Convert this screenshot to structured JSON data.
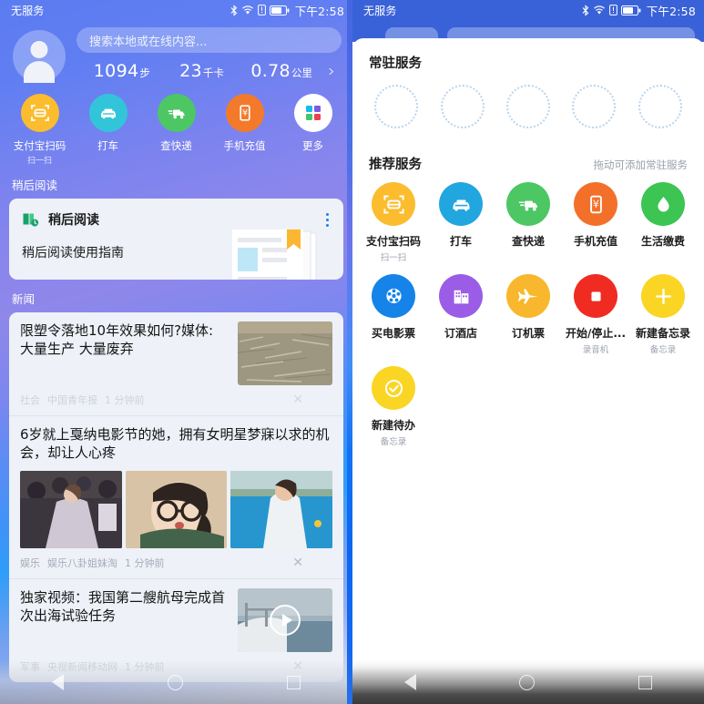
{
  "statusbar": {
    "carrier": "无服务",
    "time": "下午2:58",
    "icons": [
      "bluetooth-icon",
      "wifi-icon",
      "sim-alert-icon",
      "battery-icon"
    ]
  },
  "left_panel": {
    "search": {
      "placeholder": "搜索本地或在线内容..."
    },
    "avatar": "avatar",
    "stats": [
      {
        "num": "1094",
        "unit": "步"
      },
      {
        "num": "23",
        "unit": "千卡"
      },
      {
        "num": "0.78",
        "unit": "公里"
      }
    ],
    "stats_chevron": "›",
    "shortcuts": [
      {
        "label": "支付宝扫码",
        "sub": "扫一扫",
        "icon": "scan-code-icon",
        "color": "#fbbc2e"
      },
      {
        "label": "打车",
        "sub": "",
        "icon": "taxi-icon",
        "color": "#32c5d9"
      },
      {
        "label": "查快递",
        "sub": "",
        "icon": "delivery-truck-icon",
        "color": "#4cc764"
      },
      {
        "label": "手机充值",
        "sub": "",
        "icon": "phone-recharge-icon",
        "color": "#f37a2b"
      },
      {
        "label": "更多",
        "sub": "",
        "icon": "more-grid-icon",
        "color": "#ffffff"
      }
    ],
    "read_later": {
      "section_title": "稍后阅读",
      "card_title": "稍后阅读",
      "card_icon": "book-clock-icon",
      "menu_icon": "kebab-menu-icon",
      "item": "稍后阅读使用指南"
    },
    "news": {
      "section_title": "新闻",
      "articles": [
        {
          "title": "限塑令落地10年效果如何?媒体: 大量生产 大量废弃",
          "category": "社会",
          "source": "中国青年报",
          "time": "1 分钟前",
          "close": "✕",
          "layout": "thumb-right",
          "faded": true
        },
        {
          "title": "6岁就上戛纳电影节的她，拥有女明星梦寐以求的机会，却让人心疼",
          "category": "娱乐",
          "source": "娱乐八卦姐妹淘",
          "time": "1 分钟前",
          "close": "✕",
          "layout": "three-images",
          "faded": false
        },
        {
          "title": "独家视频：我国第二艘航母完成首次出海试验任务",
          "category": "军事",
          "source": "央视新闻移动网",
          "time": "1 分钟前",
          "close": "✕",
          "layout": "video-right",
          "faded": true
        }
      ]
    }
  },
  "right_panel": {
    "resident": {
      "title": "常驻服务",
      "slot_count": 5,
      "slot_icon": "empty-slot-ring"
    },
    "recommended": {
      "title": "推荐服务",
      "hint": "拖动可添加常驻服务",
      "items": [
        {
          "label": "支付宝扫码",
          "sub": "扫一扫",
          "icon": "scan-code-icon",
          "color": "#fbbc2e"
        },
        {
          "label": "打车",
          "sub": "",
          "icon": "taxi-icon",
          "color": "#22a6e0"
        },
        {
          "label": "查快递",
          "sub": "",
          "icon": "delivery-truck-icon",
          "color": "#4cc764"
        },
        {
          "label": "手机充值",
          "sub": "",
          "icon": "phone-recharge-icon",
          "color": "#f3702b"
        },
        {
          "label": "生活缴费",
          "sub": "",
          "icon": "water-drop-icon",
          "color": "#3cc552"
        },
        {
          "label": "买电影票",
          "sub": "",
          "icon": "film-reel-icon",
          "color": "#1583e8"
        },
        {
          "label": "订酒店",
          "sub": "",
          "icon": "hotel-icon",
          "color": "#9b5ce6"
        },
        {
          "label": "订机票",
          "sub": "",
          "icon": "airplane-icon",
          "color": "#f8b72c"
        },
        {
          "label": "开始/停止...",
          "sub": "录音机",
          "icon": "record-stop-icon",
          "color": "#f02b22"
        },
        {
          "label": "新建备忘录",
          "sub": "备忘录",
          "icon": "plus-icon",
          "color": "#fbd524"
        },
        {
          "label": "新建待办",
          "sub": "备忘录",
          "icon": "check-circle-icon",
          "color": "#fbd524"
        }
      ]
    }
  },
  "navbar": {
    "back": "back-triangle-icon",
    "home": "home-circle-icon",
    "recents": "recents-square-icon"
  },
  "colors": {
    "accent_blue": "#3a62d8",
    "left_gradient_start": "#5b7cf0",
    "card_bg": "#eef1f8"
  }
}
